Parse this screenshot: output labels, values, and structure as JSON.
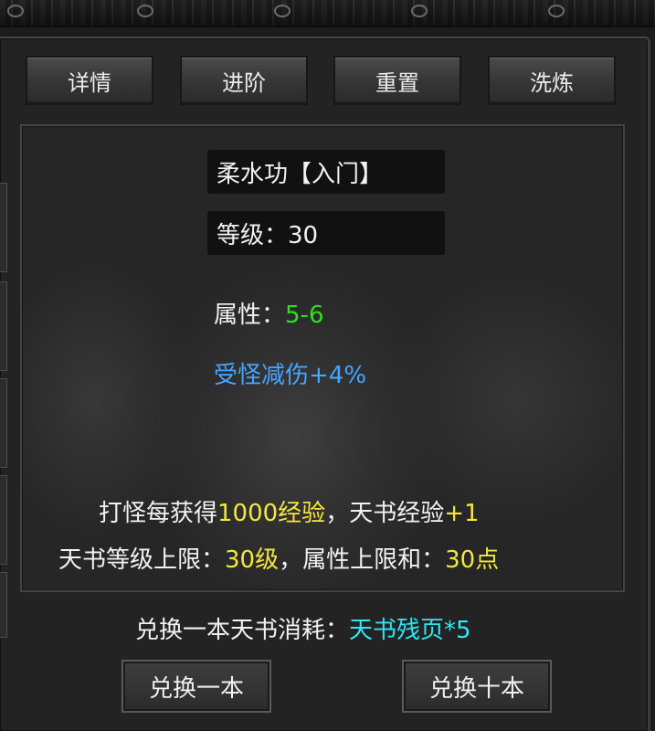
{
  "tabs": [
    {
      "label": "详情"
    },
    {
      "label": "进阶"
    },
    {
      "label": "重置"
    },
    {
      "label": "洗炼"
    }
  ],
  "skill": {
    "name": "柔水功【入门】",
    "level_text": "等级：30",
    "attr_label": "属性：",
    "attr_value": "5-6",
    "effect": "受怪减伤+4%"
  },
  "info": {
    "line1_a": "打怪每获得",
    "line1_b": "1000经验",
    "line1_c": "，天书经验",
    "line1_d": "+1",
    "line2_a": "天书等级上限：",
    "line2_b": "30级",
    "line2_c": "，属性上限和：",
    "line2_d": "30点"
  },
  "exchange": {
    "cost_label": "兑换一本天书消耗：",
    "cost_value": "天书残页*5",
    "btn_one": "兑换一本",
    "btn_ten": "兑换十本"
  },
  "colors": {
    "attr_value": "#2de021",
    "effect": "#45a5ff",
    "highlight": "#f4e640",
    "cost_value": "#2fe6f2"
  }
}
